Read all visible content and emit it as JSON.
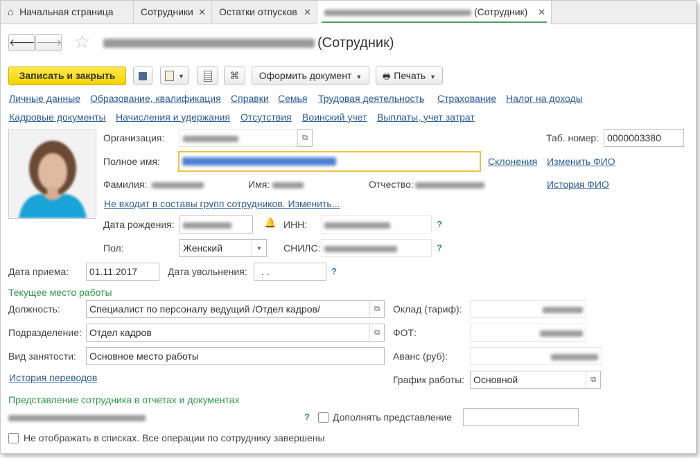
{
  "tabs": [
    {
      "label": "Начальная страница",
      "icon": "home-icon"
    },
    {
      "label": "Сотрудники",
      "close": "✕"
    },
    {
      "label": "Остатки отпусков",
      "close": "✕"
    },
    {
      "label": "(Сотрудник)",
      "close": "✕",
      "active": true
    }
  ],
  "header": {
    "title_suffix": "(Сотрудник)",
    "star": "☆"
  },
  "toolbar": {
    "save_close": "Записать и закрыть",
    "create_doc": "Оформить документ",
    "print": "Печать"
  },
  "nav_links": {
    "row1": [
      "Личные данные",
      "Образование, квалификация",
      "Справки",
      "Семья",
      "Трудовая деятельность",
      "Страхование",
      "Налог на доходы"
    ],
    "row2": [
      "Кадровые документы",
      "Начисления и удержания",
      "Отсутствия",
      "Воинский учет",
      "Выплаты, учет затрат"
    ]
  },
  "personal": {
    "org_label": "Организация:",
    "tab_num_label": "Таб. номер:",
    "tab_num_value": "0000003380",
    "full_name_label": "Полное имя:",
    "declension_link": "Склонения",
    "change_name_link": "Изменить ФИО",
    "surname_label": "Фамилия:",
    "name_label": "Имя:",
    "patronymic_label": "Отчество:",
    "name_history_link": "История ФИО",
    "groups_link": "Не входит в составы групп сотрудников. Изменить...",
    "birth_label": "Дата рождения:",
    "inn_label": "ИНН:",
    "gender_label": "Пол:",
    "gender_value": "Женский",
    "snils_label": "СНИЛС:",
    "question": "?"
  },
  "employment": {
    "hire_label": "Дата приема:",
    "hire_value": "01.11.2017",
    "dismiss_label": "Дата увольнения:",
    "dismiss_value": ". .",
    "current_place_title": "Текущее место работы",
    "position_label": "Должность:",
    "position_value": "Специалист по персоналу ведущий /Отдел кадров/",
    "department_label": "Подразделение:",
    "department_value": "Отдел кадров",
    "employment_type_label": "Вид занятости:",
    "employment_type_value": "Основное место работы",
    "transfers_link": "История переводов",
    "salary_label": "Оклад (тариф):",
    "fot_label": "ФОТ:",
    "advance_label": "Аванс (руб):",
    "schedule_label": "График работы:",
    "schedule_value": "Основной"
  },
  "presentation": {
    "title": "Представление сотрудника в отчетах и документах",
    "supplement_label": "Дополнять представление",
    "hide_label": "Не отображать в списках. Все операции по сотруднику завершены"
  }
}
